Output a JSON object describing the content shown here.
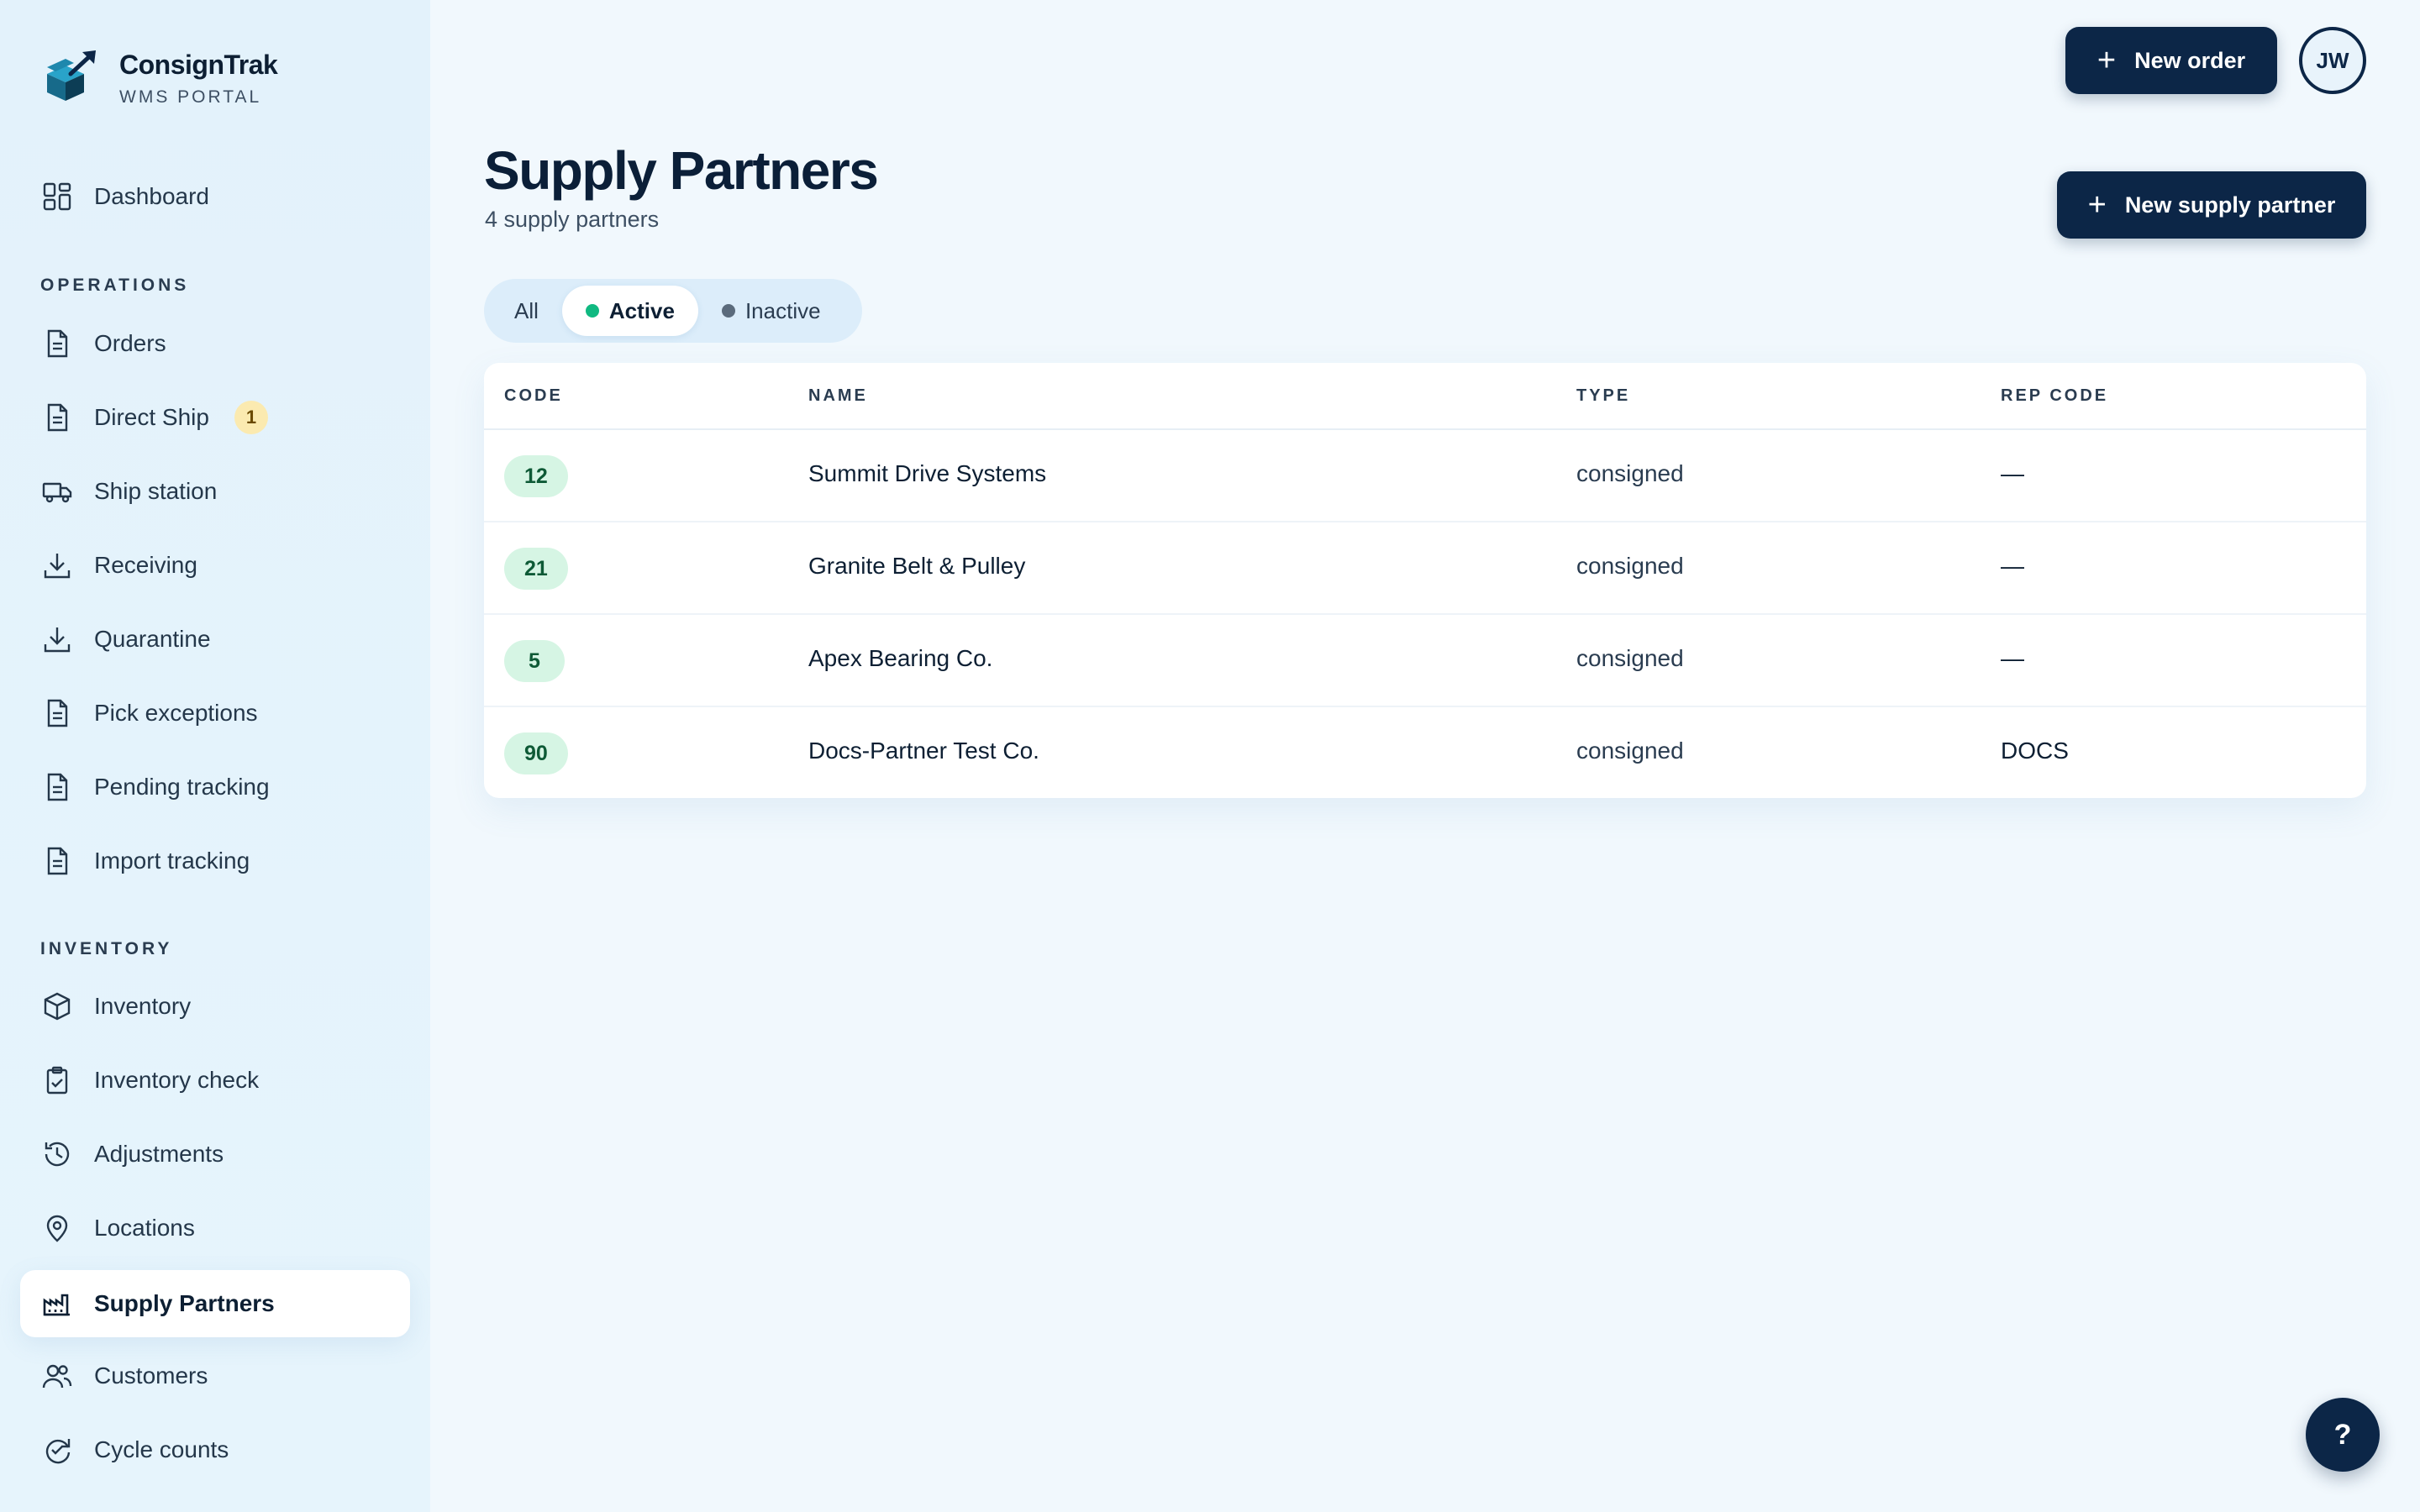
{
  "brand": {
    "name": "ConsignTrak",
    "subtitle": "WMS PORTAL"
  },
  "header": {
    "new_order_label": "New order",
    "avatar_initials": "JW"
  },
  "sidebar": {
    "dashboard": {
      "label": "Dashboard",
      "icon": "grid-icon"
    },
    "sections": [
      {
        "title": "OPERATIONS",
        "items": [
          {
            "label": "Orders",
            "icon": "document-icon"
          },
          {
            "label": "Direct Ship",
            "icon": "document-icon",
            "badge": "1"
          },
          {
            "label": "Ship station",
            "icon": "truck-icon"
          },
          {
            "label": "Receiving",
            "icon": "download-icon"
          },
          {
            "label": "Quarantine",
            "icon": "download-icon"
          },
          {
            "label": "Pick exceptions",
            "icon": "document-icon"
          },
          {
            "label": "Pending tracking",
            "icon": "document-icon"
          },
          {
            "label": "Import tracking",
            "icon": "document-icon"
          }
        ]
      },
      {
        "title": "INVENTORY",
        "items": [
          {
            "label": "Inventory",
            "icon": "cube-icon"
          },
          {
            "label": "Inventory check",
            "icon": "clipboard-check-icon"
          },
          {
            "label": "Adjustments",
            "icon": "history-icon"
          },
          {
            "label": "Locations",
            "icon": "map-pin-icon"
          },
          {
            "label": "Supply Partners",
            "icon": "factory-icon",
            "active": true
          },
          {
            "label": "Customers",
            "icon": "users-icon"
          },
          {
            "label": "Cycle counts",
            "icon": "refresh-check-icon"
          }
        ]
      }
    ]
  },
  "page": {
    "title": "Supply Partners",
    "subtitle": "4 supply partners",
    "new_partner_label": "New supply partner"
  },
  "filters": [
    {
      "label": "All"
    },
    {
      "label": "Active",
      "dot_color": "#10b981",
      "active": true
    },
    {
      "label": "Inactive",
      "dot_color": "#5b6b7c"
    }
  ],
  "table": {
    "columns": [
      "CODE",
      "NAME",
      "TYPE",
      "REP CODE"
    ],
    "rows": [
      {
        "code": "12",
        "name": "Summit Drive Systems",
        "type": "consigned",
        "rep_code": "—"
      },
      {
        "code": "21",
        "name": "Granite Belt & Pulley",
        "type": "consigned",
        "rep_code": "—"
      },
      {
        "code": "5",
        "name": "Apex Bearing Co.",
        "type": "consigned",
        "rep_code": "—"
      },
      {
        "code": "90",
        "name": "Docs-Partner Test Co.",
        "type": "consigned",
        "rep_code": "DOCS"
      }
    ]
  },
  "help": {
    "label": "?"
  },
  "colors": {
    "accent": "#0c2647",
    "active_dot": "#10b981",
    "code_pill_bg": "#d6f5e4"
  }
}
